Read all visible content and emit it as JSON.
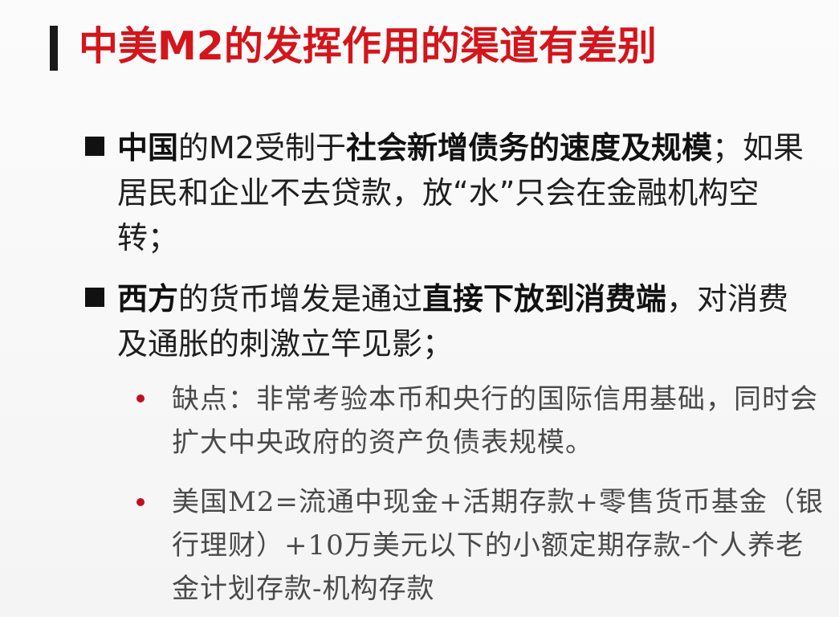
{
  "slide": {
    "title": "中美M2的发挥作用的渠道有差别",
    "bullets": [
      {
        "parts": [
          {
            "text": "中国",
            "bold": true
          },
          {
            "text": "的M2受制于",
            "bold": false
          },
          {
            "text": "社会新增债务的速度及规模",
            "bold": true
          },
          {
            "text": "；如果居民和企业不去贷款，放“水”只会在金融机构空转；",
            "bold": false
          }
        ]
      },
      {
        "parts": [
          {
            "text": "西方",
            "bold": true
          },
          {
            "text": "的货币增发是通过",
            "bold": false
          },
          {
            "text": "直接下放到消费端",
            "bold": true
          },
          {
            "text": "，对消费及通胀的刺激立竿见影；",
            "bold": false
          }
        ]
      }
    ],
    "sub_bullets": [
      "缺点：非常考验本币和央行的国际信用基础，同时会扩大中央政府的资产负债表规模。",
      "美国M2=流通中现金+活期存款+零售货币基金（银行理财）+10万美元以下的小额定期存款-个人养老金计划存款-机构存款"
    ],
    "colors": {
      "title": "#d4151b",
      "text": "#1f1f1f",
      "sub_text": "#4a4a4a",
      "sub_bullet_dot": "#c0101c",
      "main_bullet_square": "#111111"
    }
  }
}
